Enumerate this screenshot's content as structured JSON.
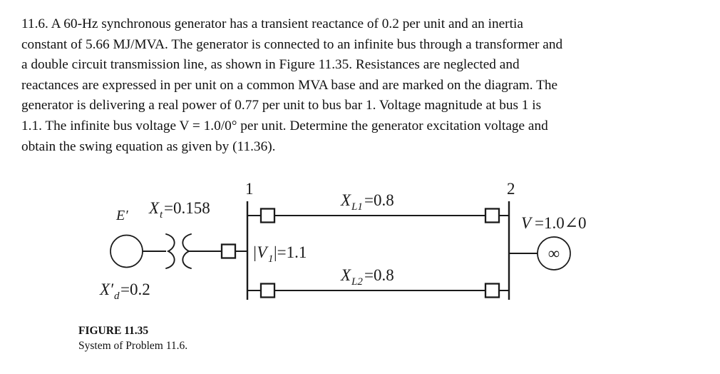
{
  "problem": {
    "number": "11.6.",
    "body": "11.6. A 60-Hz synchronous generator has a transient reactance of 0.2 per unit and an inertia constant of 5.66 MJ/MVA. The generator is connected to an infinite bus through a transformer and a double circuit transmission line, as shown in Figure 11.35. Resistances are neglected and reactances are expressed in per unit on a common MVA base and are marked on the diagram. The generator is delivering a real power of 0.77 per unit to bus bar 1. Voltage magnitude at bus 1 is 1.1. The infinite bus voltage V = 1.0/0° per unit. Determine the generator excitation voltage and obtain the swing equation as given by (11.36).",
    "lines": [
      "11.6. A 60-Hz synchronous generator has a transient reactance of 0.2 per unit and an inertia",
      "constant of 5.66 MJ/MVA. The generator is connected to an infinite bus through a transformer and",
      "a double circuit transmission line, as shown in Figure 11.35. Resistances are neglected and",
      "reactances are expressed in per unit on a common MVA base and are marked on the diagram. The",
      "generator is delivering a real power of 0.77 per unit to bus bar 1. Voltage magnitude at bus 1 is",
      "1.1. The infinite bus voltage V = 1.0/0° per unit. Determine the generator excitation voltage and",
      "obtain the swing equation as given by (11.36)."
    ]
  },
  "diagram": {
    "generator_emf_label": "E′",
    "generator_reactance_label": "X′",
    "generator_reactance_sub": "d",
    "generator_reactance_value": "=0.2",
    "transformer_label": "X",
    "transformer_sub": "t",
    "transformer_value": "=0.158",
    "bus1_number": "1",
    "bus2_number": "2",
    "bus1_voltage_label": "|V",
    "bus1_voltage_sub": "1",
    "bus1_voltage_value": "|=1.1",
    "line1_label": "X",
    "line1_sub": "L1",
    "line1_value": "=0.8",
    "line2_label": "X",
    "line2_sub": "L2",
    "line2_value": "=0.8",
    "infinite_bus_voltage_label": "V",
    "infinite_bus_voltage_value": "=1.0∠0",
    "infinite_bus_symbol": "∞",
    "stroke_color": "#1a1a1a",
    "fill_color": "#ffffff"
  },
  "caption": {
    "title": "FIGURE 11.35",
    "subtitle": "System of Problem 11.6."
  }
}
